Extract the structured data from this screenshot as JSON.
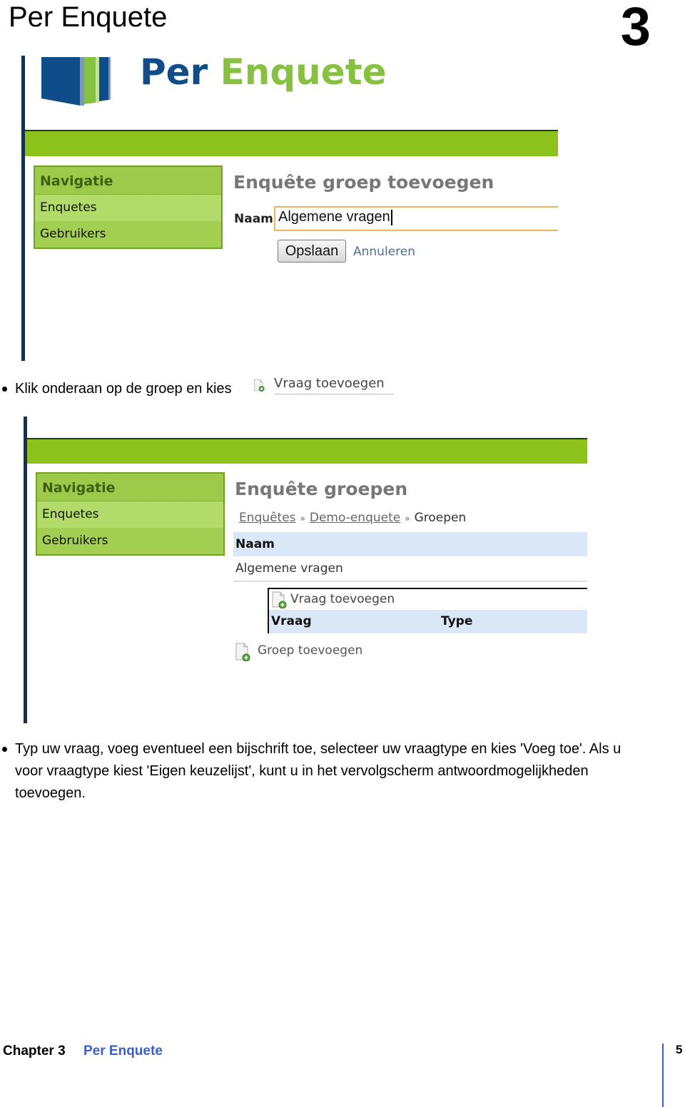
{
  "header": {
    "title": "Per Enquete",
    "chapter_number": "3"
  },
  "screenshot1": {
    "logo": {
      "part1": "Per",
      "part2": "Enquete",
      "icon": "book-logo-icon"
    },
    "colors": {
      "brand_blue": "#0f4c8a",
      "brand_green": "#86c240",
      "green_bar": "#8dc21c"
    },
    "nav": {
      "heading": "Navigatie",
      "items": [
        {
          "label": "Enquetes"
        },
        {
          "label": "Gebruikers"
        }
      ]
    },
    "heading": "Enquête groep toevoegen",
    "form": {
      "name_label": "Naam:",
      "name_value": "Algemene vragen",
      "save_label": "Opslaan",
      "cancel_label": "Annuleren"
    }
  },
  "bullet1": {
    "text": "Klik onderaan op de groep en kies",
    "inline_button": {
      "label": "Vraag toevoegen",
      "icon": "add-document-icon"
    }
  },
  "screenshot2": {
    "nav": {
      "heading": "Navigatie",
      "items": [
        {
          "label": "Enquetes"
        },
        {
          "label": "Gebruikers"
        }
      ]
    },
    "heading": "Enquête groepen",
    "breadcrumb": [
      {
        "label": "Enquêtes",
        "link": true
      },
      {
        "label": "Demo-enquete",
        "link": true
      },
      {
        "label": "Groepen",
        "link": false
      }
    ],
    "breadcrumb_separator": "»",
    "table": {
      "header": "Naam",
      "rows": [
        {
          "name": "Algemene vragen"
        }
      ]
    },
    "subtable": {
      "add_label": "Vraag toevoegen",
      "columns": [
        "Vraag",
        "Type"
      ]
    },
    "group_add_label": "Groep toevoegen"
  },
  "bullet2": {
    "lines": [
      "Typ uw vraag, voeg eventueel een bijschrift toe, selecteer uw vraagtype en kies 'Voeg toe'. Als u",
      "voor vraagtype kiest 'Eigen keuzelijst', kunt u in het vervolgscherm antwoordmogelijkheden",
      "toevoegen."
    ]
  },
  "footer": {
    "chapter": "Chapter 3",
    "title": "Per Enquete",
    "page": "5"
  }
}
